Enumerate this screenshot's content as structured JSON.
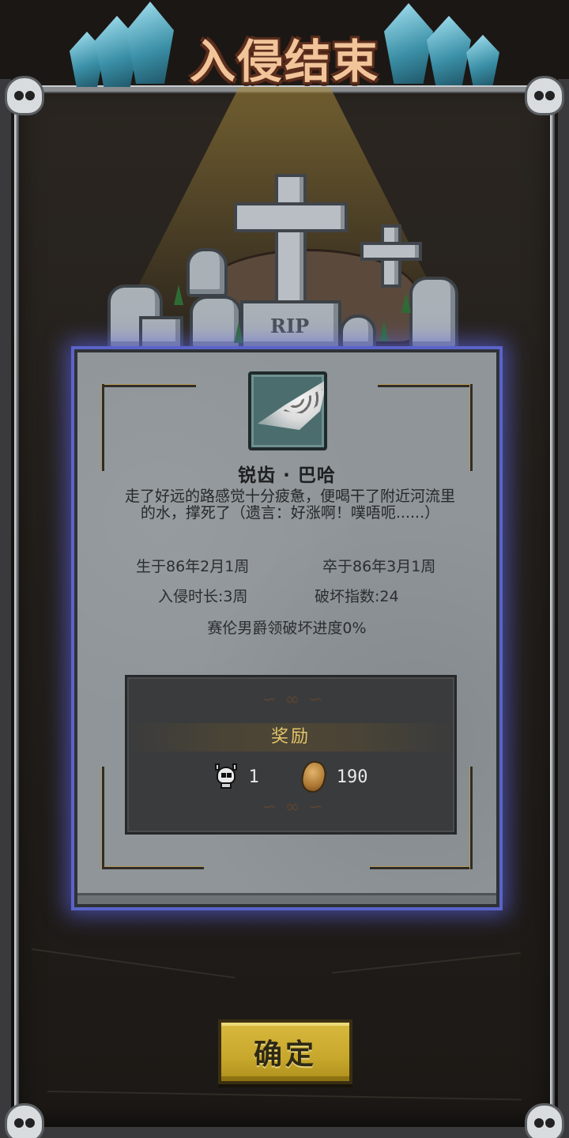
{
  "title": "入侵结束",
  "grave": {
    "rip_text": "RIP"
  },
  "item": {
    "name": "锐齿 · 巴哈",
    "icon": "fang-item-icon",
    "description": "走了好远的路感觉十分疲惫，便喝干了附近河流里的水，撑死了（遗言：好涨啊！噗唔呃......）"
  },
  "stats": {
    "born": "生于86年2月1周",
    "died": "卒于86年3月1周",
    "invasion_duration": "入侵时长:3周",
    "destruction_index": "破坏指数:24",
    "territory_progress": "赛伦男爵领破坏进度0%"
  },
  "reward": {
    "title": "奖励",
    "items": [
      {
        "icon": "skull-icon",
        "value": "1"
      },
      {
        "icon": "coin-icon",
        "value": "190"
      }
    ]
  },
  "confirm_label": "确定",
  "colors": {
    "panel_glow": "#5a63c9",
    "button": "#c8a82c",
    "reward_title": "#e4c56a",
    "title_text": "#f2c49a"
  }
}
